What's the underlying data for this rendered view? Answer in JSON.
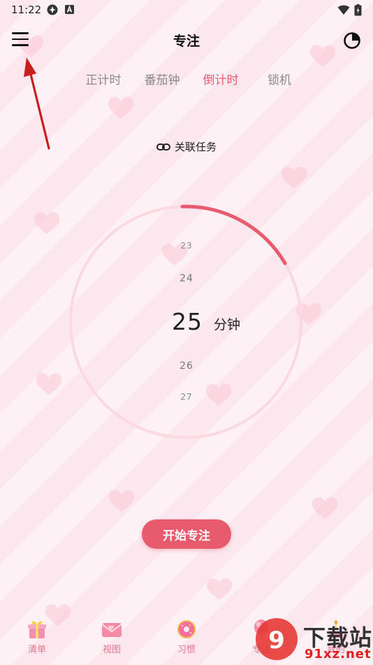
{
  "status_bar": {
    "time": "11:22"
  },
  "header": {
    "title": "专注"
  },
  "tabs": [
    {
      "label": "正计时",
      "active": false
    },
    {
      "label": "番茄钟",
      "active": false
    },
    {
      "label": "倒计时",
      "active": true
    },
    {
      "label": "锁机",
      "active": false
    }
  ],
  "link_task": {
    "label": "关联任务"
  },
  "timer": {
    "values": {
      "above2": "23",
      "above1": "24",
      "selected": "25",
      "below1": "26",
      "below2": "27"
    },
    "unit": "分钟",
    "progress_fraction": 0.17
  },
  "start_button": {
    "label": "开始专注"
  },
  "bottom_nav": [
    {
      "label": "清单",
      "icon": "gift-icon"
    },
    {
      "label": "视图",
      "icon": "envelope-icon"
    },
    {
      "label": "习惯",
      "icon": "donut-icon"
    },
    {
      "label": "专注",
      "icon": "balloon-icon"
    },
    {
      "label": "我的",
      "icon": "cake-icon"
    }
  ],
  "watermark": {
    "text": "下载站",
    "url": "91xz.net"
  },
  "colors": {
    "accent": "#e85a6e",
    "nav_label": "#e8768a",
    "ring": "#fbd9e1"
  }
}
